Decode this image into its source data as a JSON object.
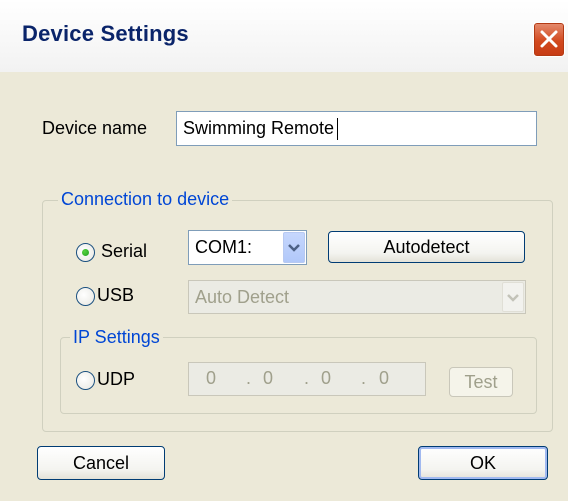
{
  "window": {
    "title": "Device Settings"
  },
  "device_name": {
    "label": "Device name",
    "value": "Swimming Remote"
  },
  "connection": {
    "group_label": "Connection to device",
    "serial": {
      "label": "Serial",
      "selected": true,
      "port_value": "COM1:",
      "autodetect_label": "Autodetect"
    },
    "usb": {
      "label": "USB",
      "selected": false,
      "device_value": "Auto Detect",
      "enabled": false
    },
    "ip": {
      "group_label": "IP Settings",
      "udp": {
        "label": "UDP",
        "selected": false
      },
      "octets": [
        "0",
        "0",
        "0",
        "0"
      ],
      "separators": [
        ".",
        ".",
        "."
      ],
      "test_label": "Test"
    }
  },
  "buttons": {
    "cancel": "Cancel",
    "ok": "OK"
  },
  "colors": {
    "title_text": "#0a246a",
    "group_text": "#0046d5",
    "close": "#d2491f",
    "dialog_bg": "#ece9d8"
  }
}
